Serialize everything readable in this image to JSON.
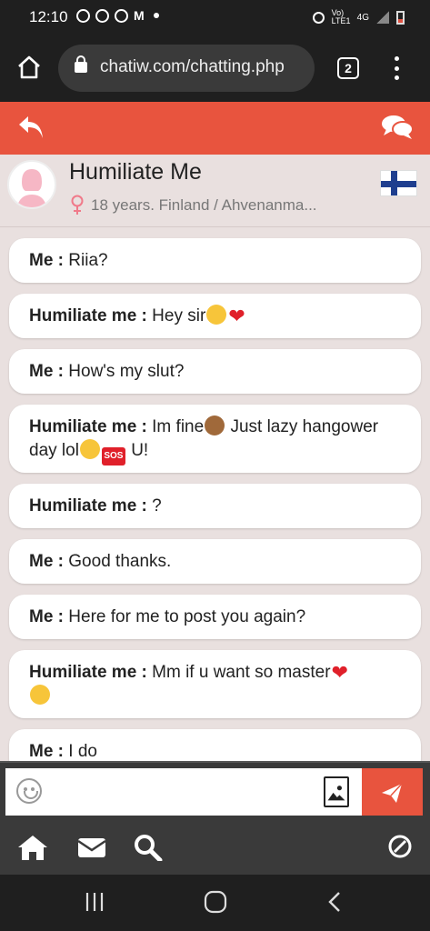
{
  "status": {
    "time": "12:10",
    "network": "4G",
    "volte": "Vo) LTE1"
  },
  "browser": {
    "url": "chatiw.com/chatting.php",
    "tab_count": "2"
  },
  "profile": {
    "name": "Humiliate Me",
    "details": "18 years. Finland / Ahvenanma...",
    "flag": "finland-flag-icon"
  },
  "messages": [
    {
      "sender": "Me :",
      "text": "Riia?"
    },
    {
      "sender": "Humiliate me :",
      "text": "Hey sir"
    },
    {
      "sender": "Me :",
      "text": "How's my slut?"
    },
    {
      "sender": "Humiliate me :",
      "text": "Im fine",
      "text2": " Just lazy hangower day lol",
      "text3": " U!"
    },
    {
      "sender": "Humiliate me :",
      "text": "?"
    },
    {
      "sender": "Me :",
      "text": "Good thanks."
    },
    {
      "sender": "Me :",
      "text": "Here for me to post you again?"
    },
    {
      "sender": "Humiliate me :",
      "text": "Mm if u want so master"
    },
    {
      "sender": "Me :",
      "text": "I do"
    }
  ],
  "composer": {
    "placeholder": ""
  },
  "colors": {
    "accent": "#e8543e",
    "background": "#e9e0df",
    "dark": "#3a3a3a"
  }
}
